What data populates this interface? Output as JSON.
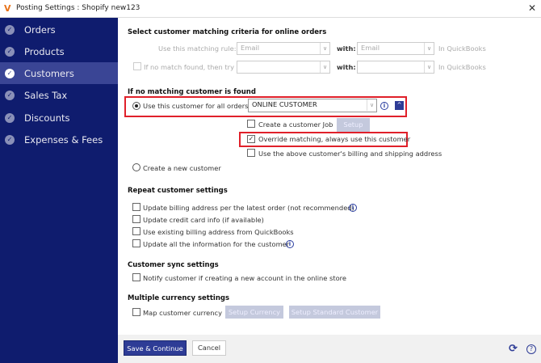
{
  "window": {
    "title": "Posting Settings : Shopify new123",
    "logo": "V",
    "close": "✕"
  },
  "sidebar": {
    "items": [
      {
        "label": "Orders"
      },
      {
        "label": "Products"
      },
      {
        "label": "Customers",
        "selected": true
      },
      {
        "label": "Sales Tax"
      },
      {
        "label": "Discounts"
      },
      {
        "label": "Expenses & Fees"
      }
    ]
  },
  "matching": {
    "heading": "Select customer matching criteria for online orders",
    "rule_label": "Use this matching rule:",
    "rule_value": "Email",
    "with_label": "with:",
    "with_value": "Email",
    "in_qb": "In QuickBooks",
    "fallback_label": "If no match found, then try",
    "fallback_value": "",
    "fallback_with_value": ""
  },
  "no_match": {
    "heading": "If no matching customer is found",
    "use_customer_label": "Use this customer for all orders:",
    "customer_value": "ONLINE CUSTOMER",
    "create_job_label": "Create a customer Job",
    "setup_label": "Setup",
    "override_label": "Override matching, always use this customer",
    "use_address_label": "Use the above customer's billing and shipping address",
    "create_new_label": "Create a new customer"
  },
  "repeat": {
    "heading": "Repeat customer settings",
    "items": [
      {
        "label": "Update billing address per the latest order (not recommended)"
      },
      {
        "label": "Update credit card info (if available)"
      },
      {
        "label": "Use existing billing address from QuickBooks"
      },
      {
        "label": "Update all the information for the customer"
      }
    ]
  },
  "sync": {
    "heading": "Customer sync settings",
    "notify_label": "Notify customer if creating a new account in the online store"
  },
  "currency": {
    "heading": "Multiple currency settings",
    "map_label": "Map customer currency",
    "setup_currency": "Setup Currency",
    "setup_standard": "Setup Standard Customer"
  },
  "footer": {
    "save": "Save & Continue",
    "cancel": "Cancel",
    "refresh_icon": "⟳",
    "help_icon": "?"
  },
  "colors": {
    "sidebar": "#0f1c6e",
    "accent": "#2e3c96",
    "highlight": "#e0202a"
  }
}
